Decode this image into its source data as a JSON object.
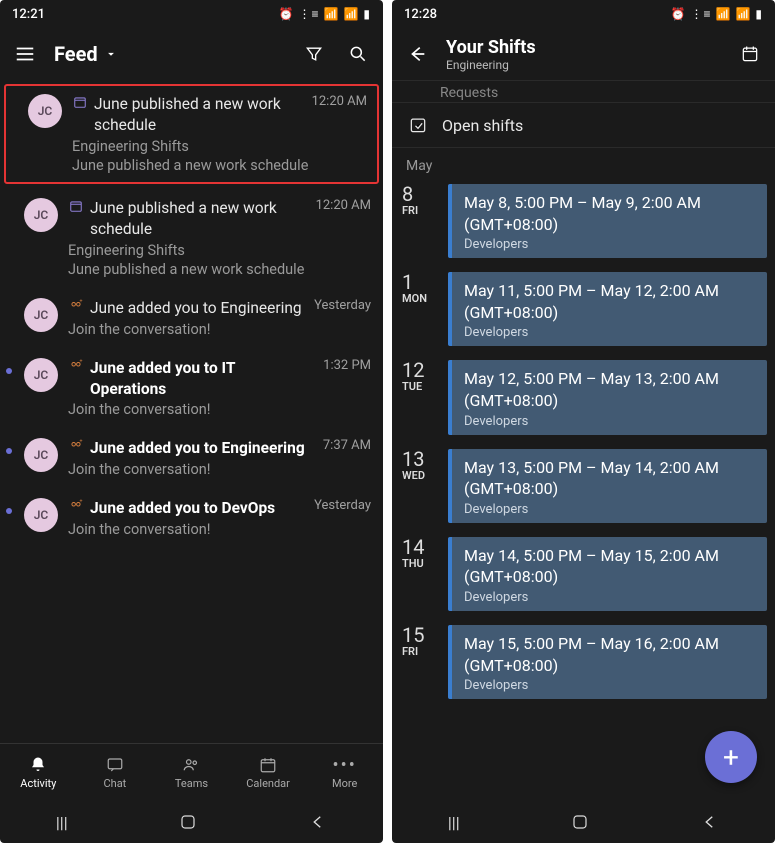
{
  "left": {
    "status_time": "12:21",
    "header_title": "Feed",
    "feed": [
      {
        "hilite": true,
        "dot": false,
        "bold": false,
        "initials": "JC",
        "icon": "calendar",
        "title": "June published a new work schedule",
        "time": "12:20 AM",
        "sub1": "Engineering Shifts",
        "sub2": "June published a new work schedule"
      },
      {
        "hilite": false,
        "dot": false,
        "bold": false,
        "initials": "JC",
        "icon": "calendar",
        "title": "June published a new work schedule",
        "time": "12:20 AM",
        "sub1": "Engineering Shifts",
        "sub2": "June published a new work schedule"
      },
      {
        "hilite": false,
        "dot": false,
        "bold": false,
        "initials": "JC",
        "icon": "people",
        "title": "June added you to Engineering",
        "time": "Yesterday",
        "sub1": "Join the conversation!",
        "sub2": ""
      },
      {
        "hilite": false,
        "dot": true,
        "bold": true,
        "initials": "JC",
        "icon": "people",
        "title": "June added you to IT Operations",
        "time": "1:32 PM",
        "sub1": "Join the conversation!",
        "sub2": ""
      },
      {
        "hilite": false,
        "dot": true,
        "bold": true,
        "initials": "JC",
        "icon": "people",
        "title": "June added you to Engineering",
        "time": "7:37 AM",
        "sub1": "Join the conversation!",
        "sub2": ""
      },
      {
        "hilite": false,
        "dot": true,
        "bold": true,
        "initials": "JC",
        "icon": "people",
        "title": "June added you to DevOps",
        "time": "Yesterday",
        "sub1": "Join the conversation!",
        "sub2": ""
      }
    ],
    "nav": [
      {
        "label": "Activity",
        "icon": "bell",
        "active": true
      },
      {
        "label": "Chat",
        "icon": "chat",
        "active": false
      },
      {
        "label": "Teams",
        "icon": "teams",
        "active": false
      },
      {
        "label": "Calendar",
        "icon": "calendar",
        "active": false
      },
      {
        "label": "More",
        "icon": "more",
        "active": false
      }
    ]
  },
  "right": {
    "status_time": "12:28",
    "header_title": "Your Shifts",
    "header_sub": "Engineering",
    "partial_row": "Requests",
    "open_shifts": "Open shifts",
    "month": "May",
    "shifts": [
      {
        "num": "8",
        "wk": "FRI",
        "time": "May 8, 5:00 PM – May 9, 2:00 AM (GMT+08:00)",
        "group": "Developers"
      },
      {
        "num": "1",
        "wk": "MON",
        "time": "May 11, 5:00 PM – May 12, 2:00 AM (GMT+08:00)",
        "group": "Developers"
      },
      {
        "num": "12",
        "wk": "TUE",
        "time": "May 12, 5:00 PM – May 13, 2:00 AM (GMT+08:00)",
        "group": "Developers"
      },
      {
        "num": "13",
        "wk": "WED",
        "time": "May 13, 5:00 PM – May 14, 2:00 AM (GMT+08:00)",
        "group": "Developers"
      },
      {
        "num": "14",
        "wk": "THU",
        "time": "May 14, 5:00 PM – May 15, 2:00 AM (GMT+08:00)",
        "group": "Developers"
      },
      {
        "num": "15",
        "wk": "FRI",
        "time": "May 15, 5:00 PM – May 16, 2:00 AM (GMT+08:00)",
        "group": "Developers"
      }
    ]
  }
}
